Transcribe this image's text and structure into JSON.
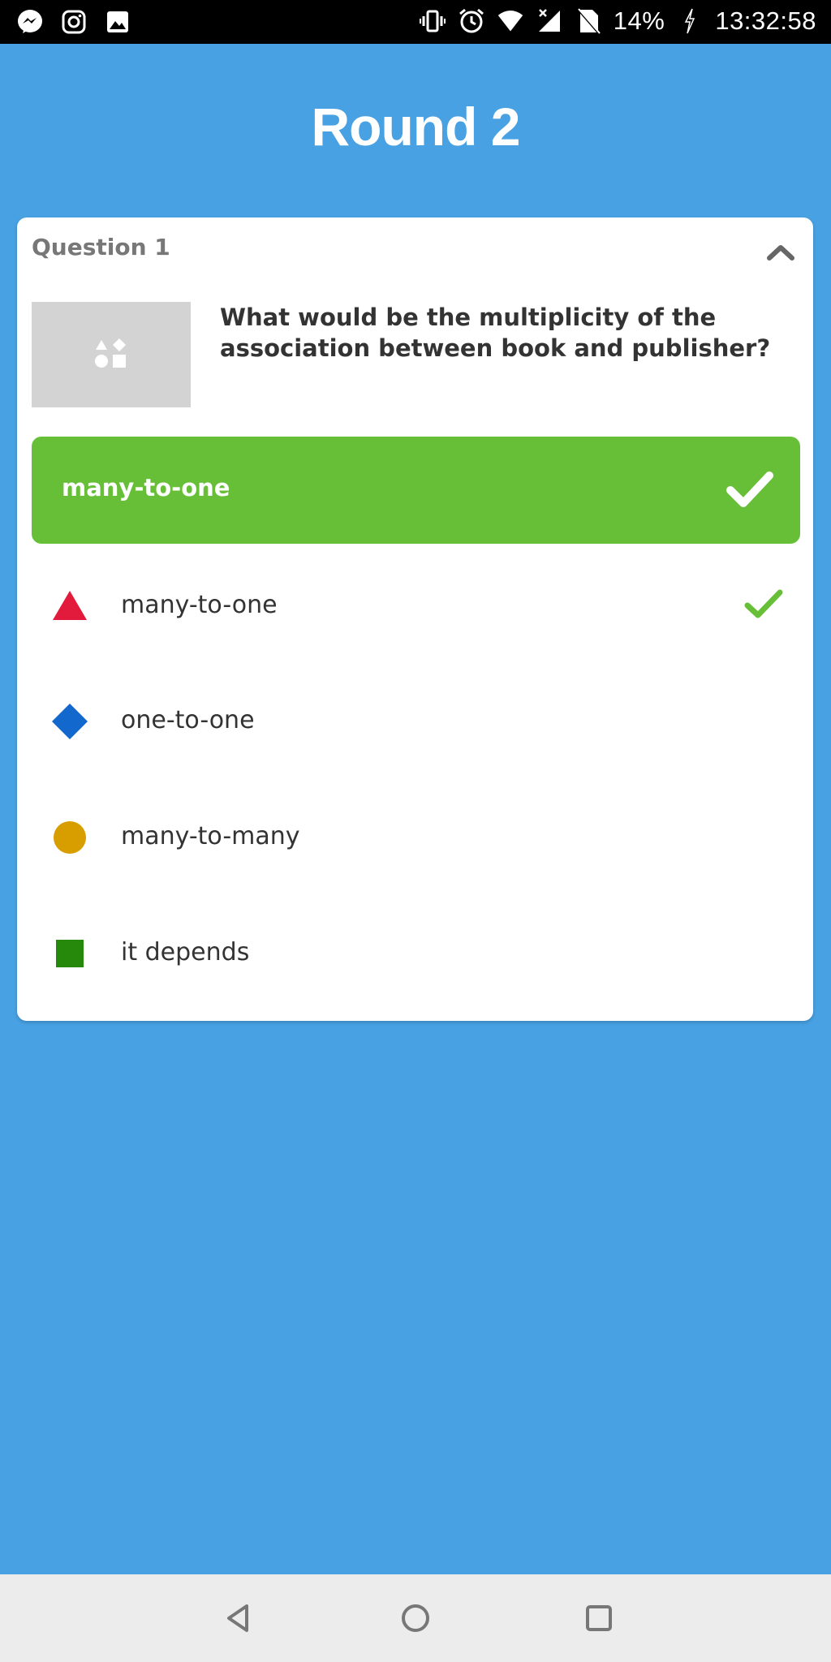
{
  "status_bar": {
    "battery": "14%",
    "time": "13:32:58",
    "left_icons": [
      "messenger-icon",
      "instagram-icon",
      "image-icon"
    ],
    "right_icons": [
      "vibrate-icon",
      "alarm-icon",
      "wifi-icon",
      "signal-icon",
      "no-sim-icon",
      "battery-icon"
    ]
  },
  "round": {
    "title": "Round 2"
  },
  "question": {
    "label": "Question 1",
    "text": "What would be the multiplicity of the association between book and publisher?",
    "image_icon": "shapes-icon"
  },
  "correct_answer": {
    "text": "many-to-one",
    "icon": "check-icon",
    "color": "#66bf37"
  },
  "options": [
    {
      "label": "many-to-one",
      "shape": "triangle",
      "color": "#e21b3c",
      "correct": true
    },
    {
      "label": "one-to-one",
      "shape": "diamond",
      "color": "#1368ce",
      "correct": false
    },
    {
      "label": "many-to-many",
      "shape": "circle",
      "color": "#d89e00",
      "correct": false
    },
    {
      "label": "it depends",
      "shape": "square",
      "color": "#26890c",
      "correct": false
    }
  ],
  "colors": {
    "background": "#47a1e2",
    "card": "#ffffff",
    "check": "#66bf37"
  },
  "nav": [
    "back-icon",
    "home-icon",
    "recents-icon"
  ]
}
